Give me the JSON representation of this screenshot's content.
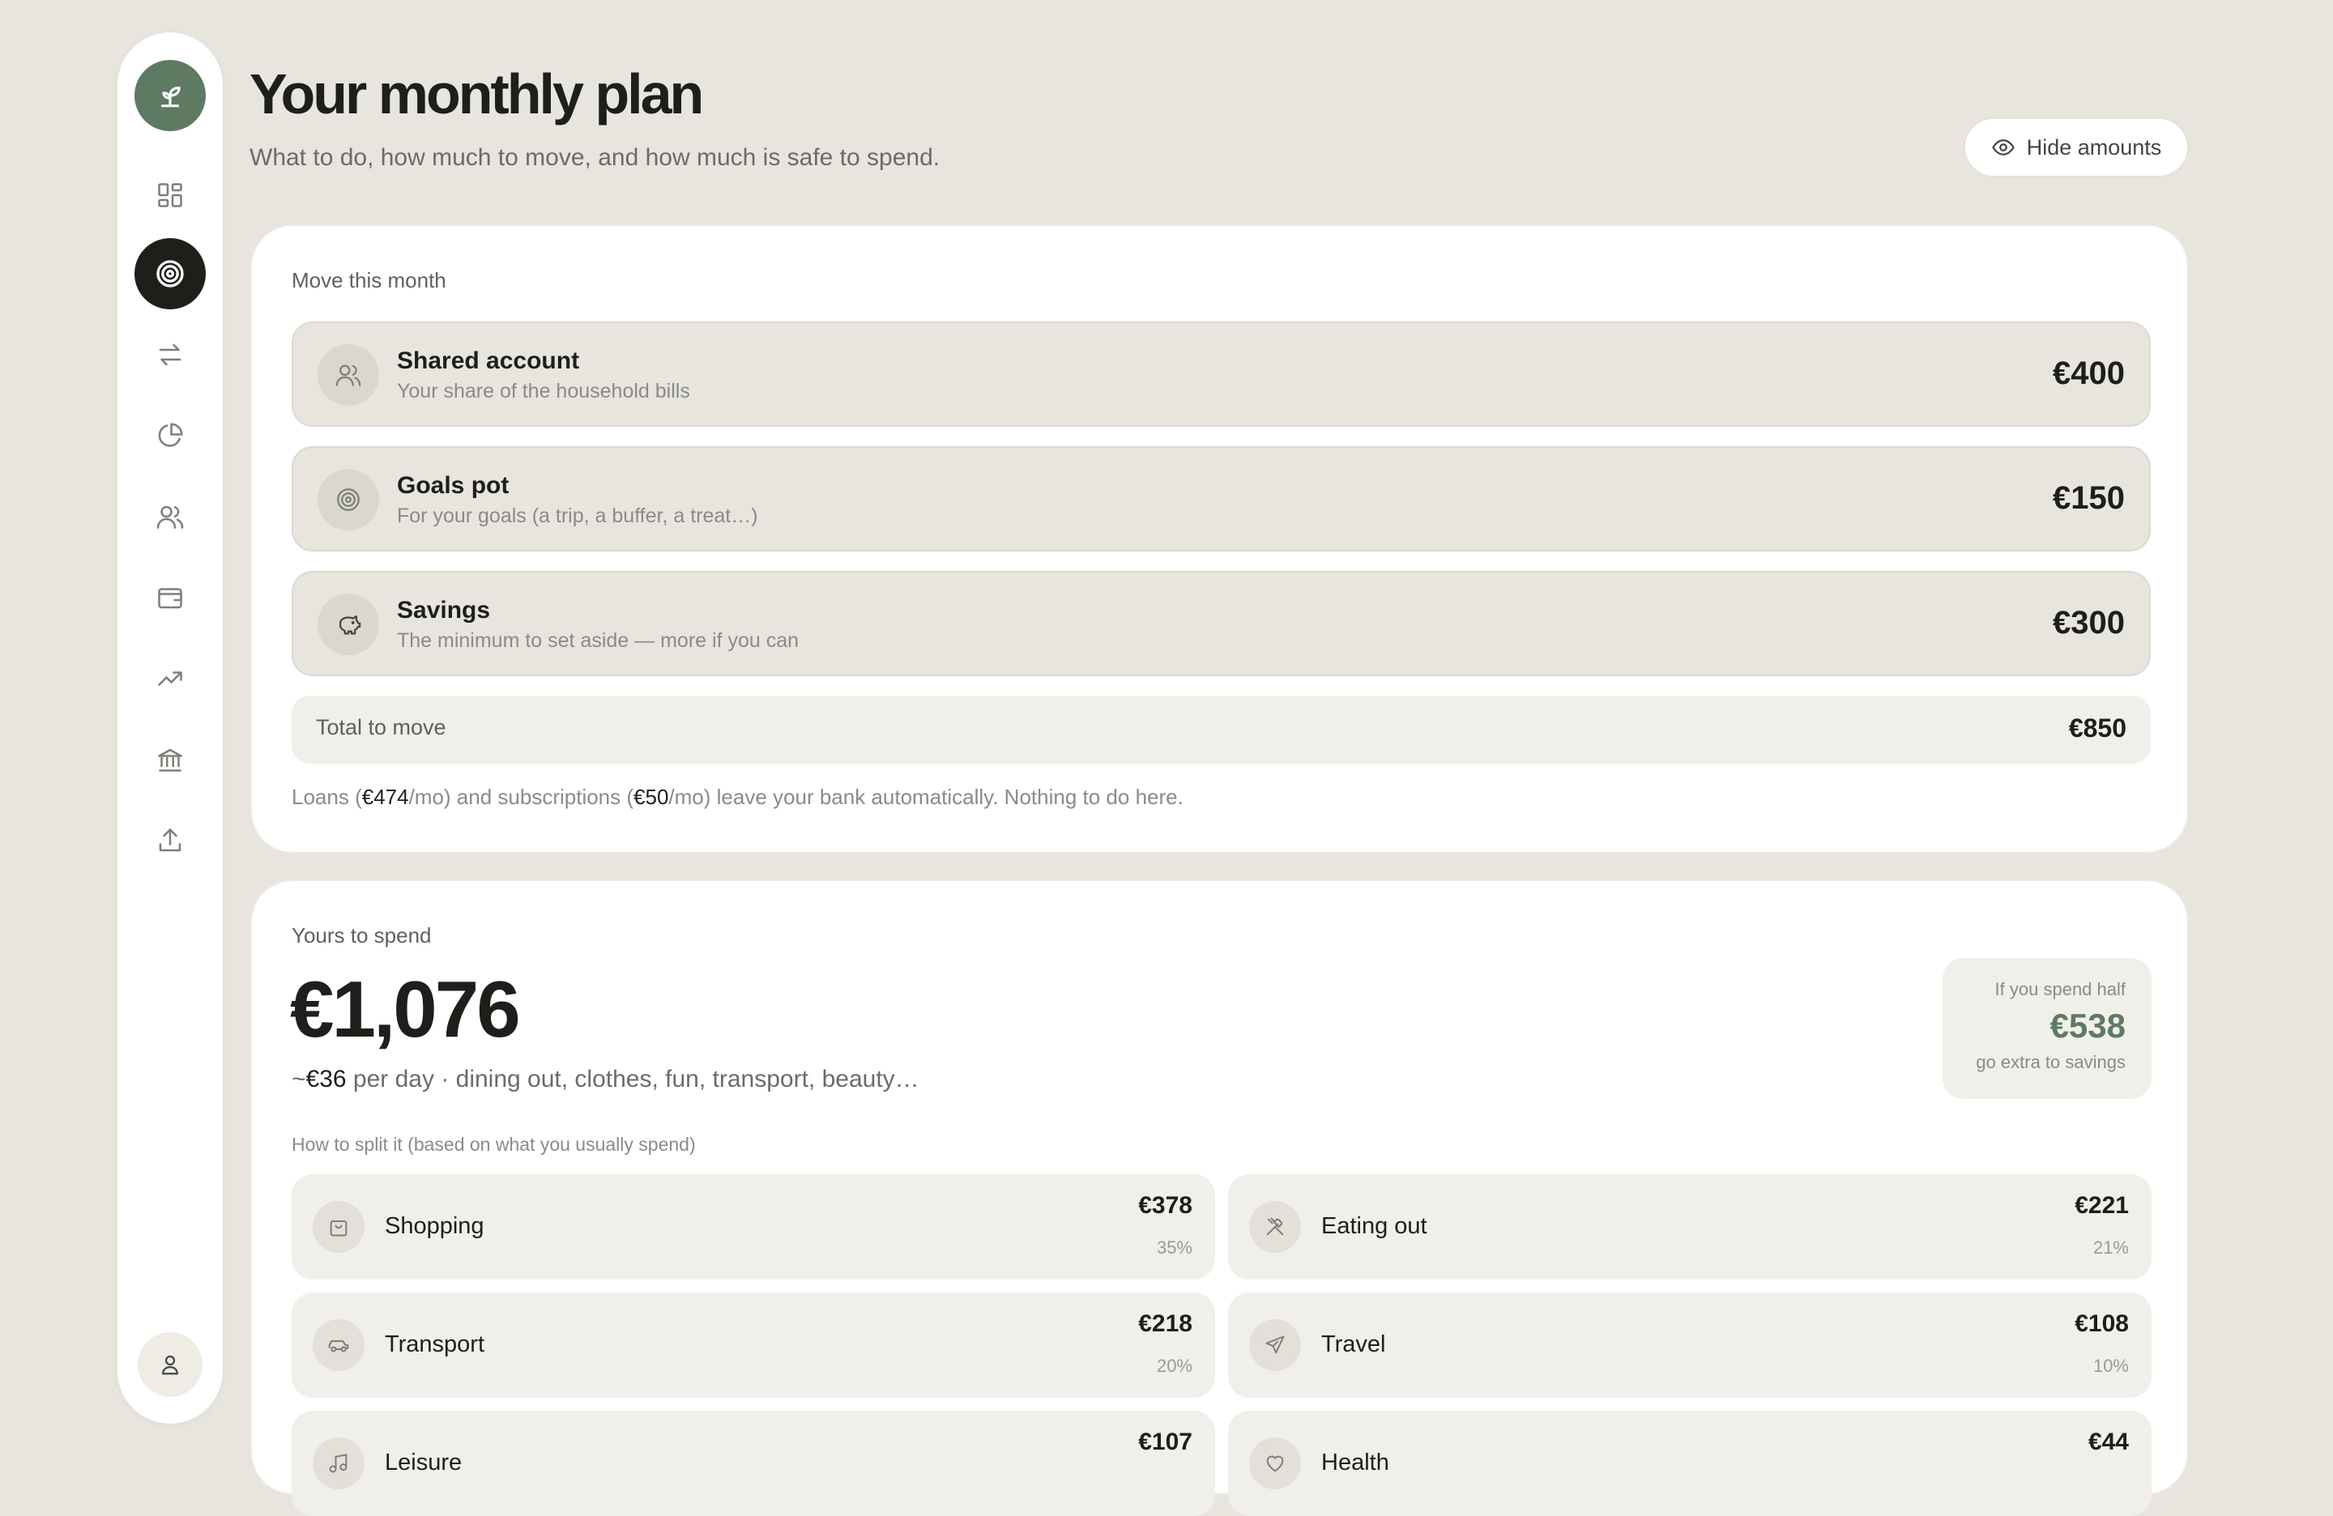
{
  "colors": {
    "accent": "#5e7a62",
    "background": "#e8e5de",
    "active_nav": "#1d1f1b"
  },
  "sidebar": {
    "logo_icon": "sprout-icon",
    "items": [
      {
        "icon": "dashboard-grid-icon",
        "active": false
      },
      {
        "icon": "target-icon",
        "active": true
      },
      {
        "icon": "transfer-arrows-icon",
        "active": false
      },
      {
        "icon": "pie-chart-icon",
        "active": false
      },
      {
        "icon": "users-icon",
        "active": false
      },
      {
        "icon": "wallet-icon",
        "active": false
      },
      {
        "icon": "trending-up-icon",
        "active": false
      },
      {
        "icon": "bank-icon",
        "active": false
      },
      {
        "icon": "upload-icon",
        "active": false
      }
    ],
    "profile_icon": "user-icon"
  },
  "header": {
    "title": "Your monthly plan",
    "subtitle": "What to do, how much to move, and how much is safe to spend.",
    "hide_amounts_label": "Hide amounts"
  },
  "move": {
    "label": "Move this month",
    "items": [
      {
        "icon": "users-icon",
        "title": "Shared account",
        "description": "Your share of the household bills",
        "amount": "€400"
      },
      {
        "icon": "target-icon",
        "title": "Goals pot",
        "description": "For your goals (a trip, a buffer, a treat…)",
        "amount": "€150"
      },
      {
        "icon": "piggy-bank-icon",
        "title": "Savings",
        "description": "The minimum to set aside — more if you can",
        "amount": "€300"
      }
    ],
    "total_label": "Total to move",
    "total_value": "€850",
    "note": {
      "part1": "Loans (",
      "loans": "€474",
      "part2": "/mo) and subscriptions (",
      "subs": "€50",
      "part3": "/mo) leave your bank automatically. Nothing to do here."
    }
  },
  "spend": {
    "label": "Yours to spend",
    "total": "€1,076",
    "per_day_prefix": "~",
    "per_day_value": "€36",
    "per_day_text": " per day · dining out, clothes, fun, transport, beauty…",
    "half": {
      "label": "If you spend half",
      "value": "€538",
      "note": "go extra to savings"
    },
    "split_label": "How to split it (based on what you usually spend)",
    "categories": [
      {
        "icon": "shopping-bag-icon",
        "name": "Shopping",
        "amount": "€378",
        "pct": "35%"
      },
      {
        "icon": "utensils-icon",
        "name": "Eating out",
        "amount": "€221",
        "pct": "21%"
      },
      {
        "icon": "car-icon",
        "name": "Transport",
        "amount": "€218",
        "pct": "20%"
      },
      {
        "icon": "plane-icon",
        "name": "Travel",
        "amount": "€108",
        "pct": "10%"
      },
      {
        "icon": "music-icon",
        "name": "Leisure",
        "amount": "€107",
        "pct": ""
      },
      {
        "icon": "heart-icon",
        "name": "Health",
        "amount": "€44",
        "pct": ""
      }
    ]
  }
}
